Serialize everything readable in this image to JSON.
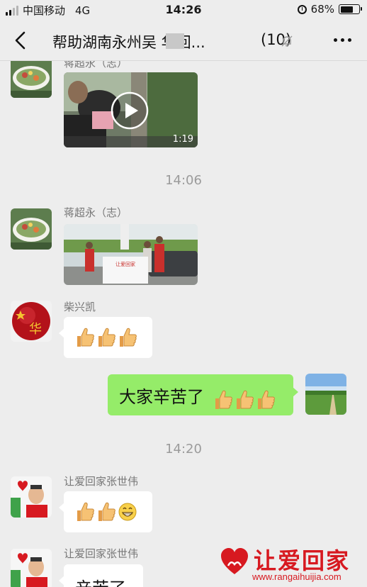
{
  "status_bar": {
    "carrier": "中国移动",
    "network": "4G",
    "time": "14:26",
    "battery": "68%",
    "battery_level": 0.68
  },
  "nav": {
    "title": "帮助湖南永州吴  华回...",
    "count": "(10)"
  },
  "messages": {
    "m1": {
      "sender": "蒋超永（志）",
      "type": "video",
      "duration": "1:19"
    },
    "t1": "14:06",
    "m2": {
      "sender": "蒋超永（志）",
      "type": "image",
      "banner": "让爱回家"
    },
    "m3": {
      "sender": "柴兴凯",
      "type": "emoji",
      "emojis": [
        "thumbs-up",
        "thumbs-up",
        "thumbs-up"
      ],
      "avatar_text": "华"
    },
    "m4": {
      "sender": "me",
      "text": "大家辛苦了",
      "emojis": [
        "thumbs-up",
        "thumbs-up",
        "thumbs-up"
      ]
    },
    "t2": "14:20",
    "m5": {
      "sender": "让爱回家张世伟",
      "type": "emoji",
      "emojis": [
        "thumbs-up",
        "thumbs-up",
        "grin"
      ]
    },
    "m6": {
      "sender": "让爱回家张世伟",
      "text": "辛苦了"
    }
  },
  "watermark": {
    "name": "让爱回家",
    "url": "www.rangaihuijia.com"
  },
  "colors": {
    "background": "#ededed",
    "outgoing_bubble": "#95ec69",
    "incoming_bubble": "#ffffff",
    "brand_red": "#d71920"
  }
}
